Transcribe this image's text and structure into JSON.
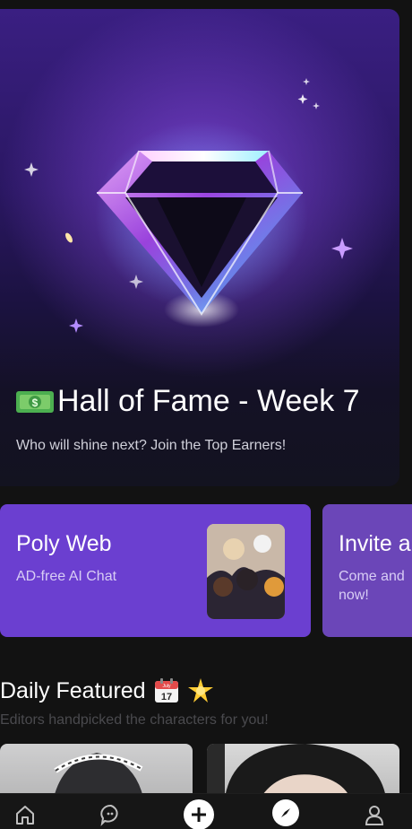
{
  "hero": {
    "title": "Hall of Fame - Week 7",
    "subtitle": "Who will shine next? Join the Top Earners!",
    "title_icon": "money-bill-emoji",
    "art": "diamond-illustration"
  },
  "cards": [
    {
      "title": "Poly Web",
      "subtitle": "AD-free AI Chat",
      "color": "#6b3fd0"
    },
    {
      "title": "Invite a",
      "subtitle_line1": "Come and",
      "subtitle_line2": "now!",
      "color": "#6b46b8"
    }
  ],
  "daily_featured": {
    "title": "Daily Featured",
    "subtitle": "Editors handpicked the characters for you!",
    "icons": [
      "calendar-emoji",
      "star-emoji"
    ],
    "calendar_text": "July 17"
  },
  "bottom_nav": [
    "home-icon",
    "chat-icon",
    "add-icon",
    "explore-icon",
    "profile-icon"
  ],
  "colors": {
    "background": "#121212",
    "accent": "#6b3fd0"
  }
}
